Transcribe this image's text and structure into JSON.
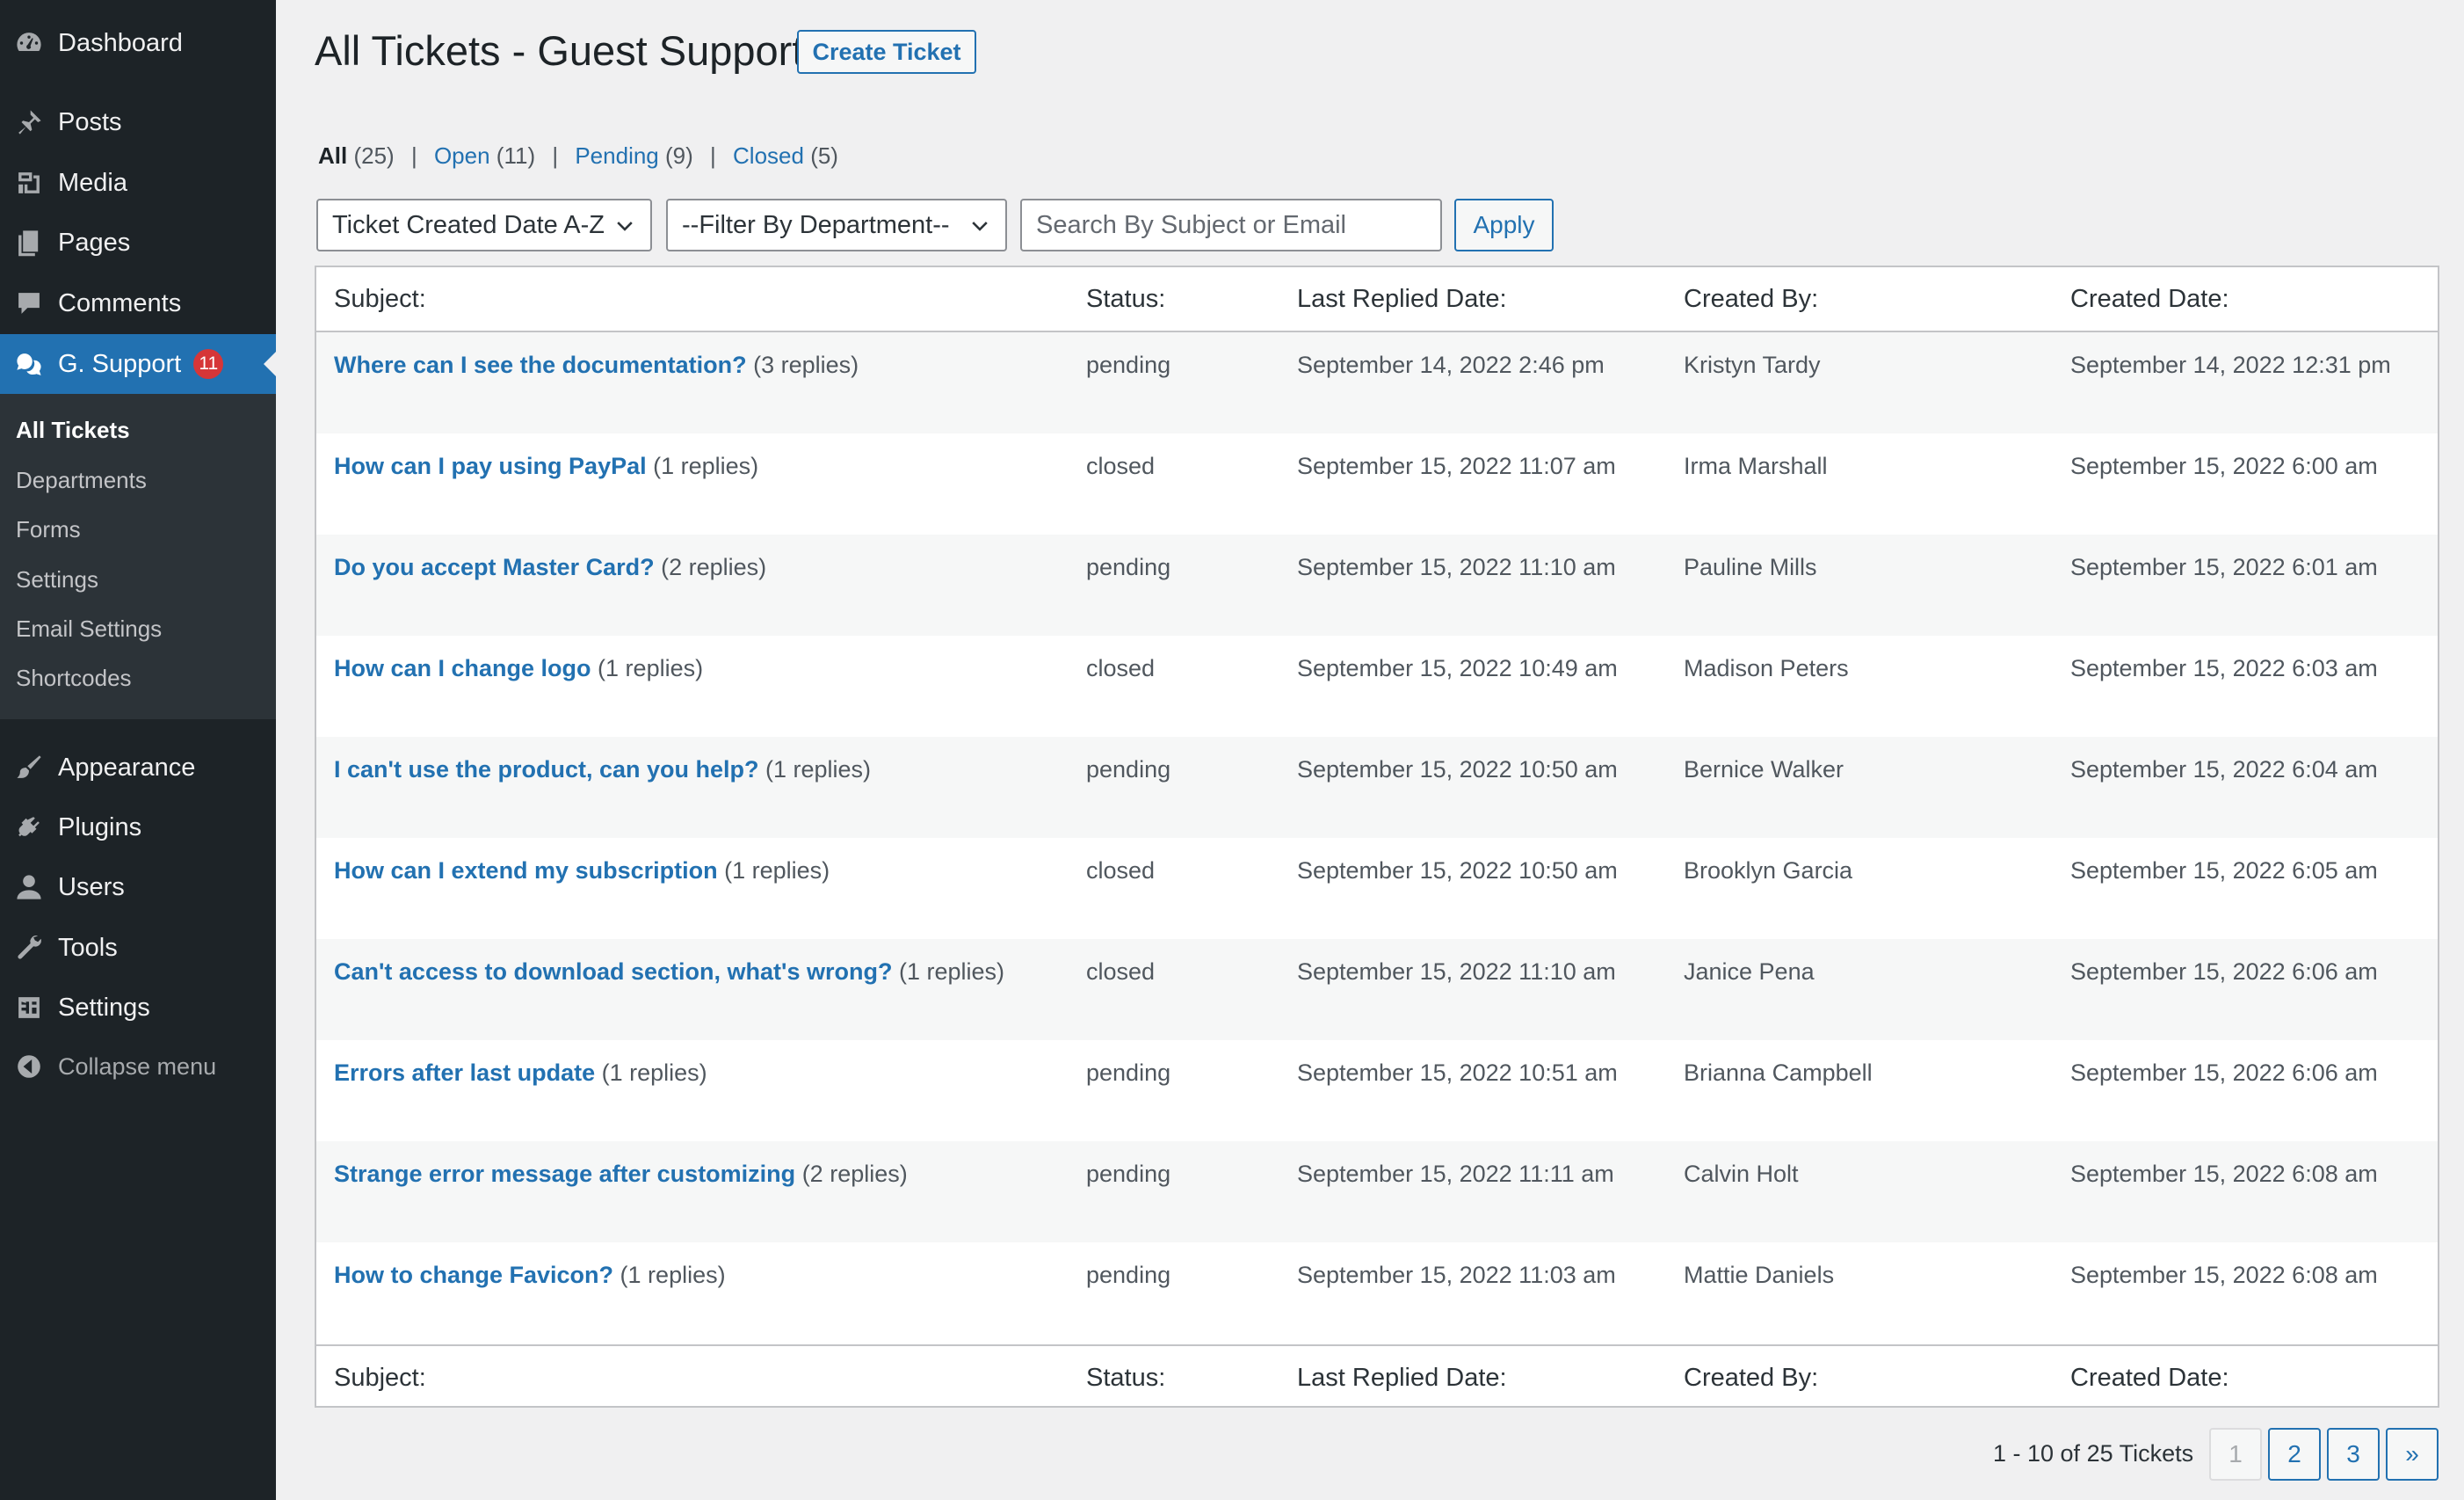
{
  "sidebar": {
    "menu": [
      {
        "label": "Dashboard",
        "icon": "dashboard-icon"
      },
      {
        "label": "Posts",
        "icon": "pin-icon"
      },
      {
        "label": "Media",
        "icon": "media-icon"
      },
      {
        "label": "Pages",
        "icon": "pages-icon"
      },
      {
        "label": "Comments",
        "icon": "comment-icon"
      },
      {
        "label": "G. Support",
        "icon": "support-icon",
        "badge": "11"
      }
    ],
    "submenu": [
      "All Tickets",
      "Departments",
      "Forms",
      "Settings",
      "Email Settings",
      "Shortcodes"
    ],
    "menu_lower": [
      {
        "label": "Appearance",
        "icon": "brush-icon"
      },
      {
        "label": "Plugins",
        "icon": "plugin-icon"
      },
      {
        "label": "Users",
        "icon": "user-icon"
      },
      {
        "label": "Tools",
        "icon": "wrench-icon"
      },
      {
        "label": "Settings",
        "icon": "settings-icon"
      }
    ],
    "collapse_label": "Collapse menu"
  },
  "header": {
    "title": "All Tickets - Guest Support",
    "create_button": "Create Ticket"
  },
  "views": {
    "all": {
      "label": "All",
      "count": "(25)"
    },
    "open": {
      "label": "Open",
      "count": "(11)"
    },
    "pending": {
      "label": "Pending",
      "count": "(9)"
    },
    "closed": {
      "label": "Closed",
      "count": "(5)"
    },
    "separator": "|"
  },
  "filters": {
    "sort_selected": "Ticket Created Date A-Z",
    "department_selected": "--Filter By Department--",
    "search_placeholder": "Search By Subject or Email",
    "apply_label": "Apply"
  },
  "table": {
    "columns": [
      "Subject:",
      "Status:",
      "Last Replied Date:",
      "Created By:",
      "Created Date:"
    ],
    "rows": [
      {
        "subject": "Where can I see the documentation?",
        "replies": "(3 replies)",
        "status": "pending",
        "last_replied": "September 14, 2022 2:46 pm",
        "created_by": "Kristyn Tardy",
        "created": "September 14, 2022 12:31 pm"
      },
      {
        "subject": "How can I pay using PayPal",
        "replies": "(1 replies)",
        "status": "closed",
        "last_replied": "September 15, 2022 11:07 am",
        "created_by": "Irma Marshall",
        "created": "September 15, 2022 6:00 am"
      },
      {
        "subject": "Do you accept Master Card?",
        "replies": "(2 replies)",
        "status": "pending",
        "last_replied": "September 15, 2022 11:10 am",
        "created_by": "Pauline Mills",
        "created": "September 15, 2022 6:01 am"
      },
      {
        "subject": "How can I change logo",
        "replies": "(1 replies)",
        "status": "closed",
        "last_replied": "September 15, 2022 10:49 am",
        "created_by": "Madison Peters",
        "created": "September 15, 2022 6:03 am"
      },
      {
        "subject": "I can't use the product, can you help?",
        "replies": "(1 replies)",
        "status": "pending",
        "last_replied": "September 15, 2022 10:50 am",
        "created_by": "Bernice Walker",
        "created": "September 15, 2022 6:04 am"
      },
      {
        "subject": "How can I extend my subscription",
        "replies": "(1 replies)",
        "status": "closed",
        "last_replied": "September 15, 2022 10:50 am",
        "created_by": "Brooklyn Garcia",
        "created": "September 15, 2022 6:05 am"
      },
      {
        "subject": "Can't access to download section, what's wrong?",
        "replies": "(1 replies)",
        "status": "closed",
        "last_replied": "September 15, 2022 11:10 am",
        "created_by": "Janice Pena",
        "created": "September 15, 2022 6:06 am"
      },
      {
        "subject": "Errors after last update",
        "replies": "(1 replies)",
        "status": "pending",
        "last_replied": "September 15, 2022 10:51 am",
        "created_by": "Brianna Campbell",
        "created": "September 15, 2022 6:06 am"
      },
      {
        "subject": "Strange error message after customizing",
        "replies": "(2 replies)",
        "status": "pending",
        "last_replied": "September 15, 2022 11:11 am",
        "created_by": "Calvin Holt",
        "created": "September 15, 2022 6:08 am"
      },
      {
        "subject": "How to change Favicon?",
        "replies": "(1 replies)",
        "status": "pending",
        "last_replied": "September 15, 2022 11:03 am",
        "created_by": "Mattie Daniels",
        "created": "September 15, 2022 6:08 am"
      }
    ]
  },
  "pagination": {
    "info": "1 - 10 of 25 Tickets",
    "pages": [
      "1",
      "2",
      "3"
    ],
    "current_page": "1",
    "next": "»"
  },
  "colors": {
    "sidebar_bg": "#1d2327",
    "submenu_bg": "#2c3338",
    "accent": "#2271b1",
    "badge": "#d63638",
    "page_bg": "#f0f0f1"
  }
}
